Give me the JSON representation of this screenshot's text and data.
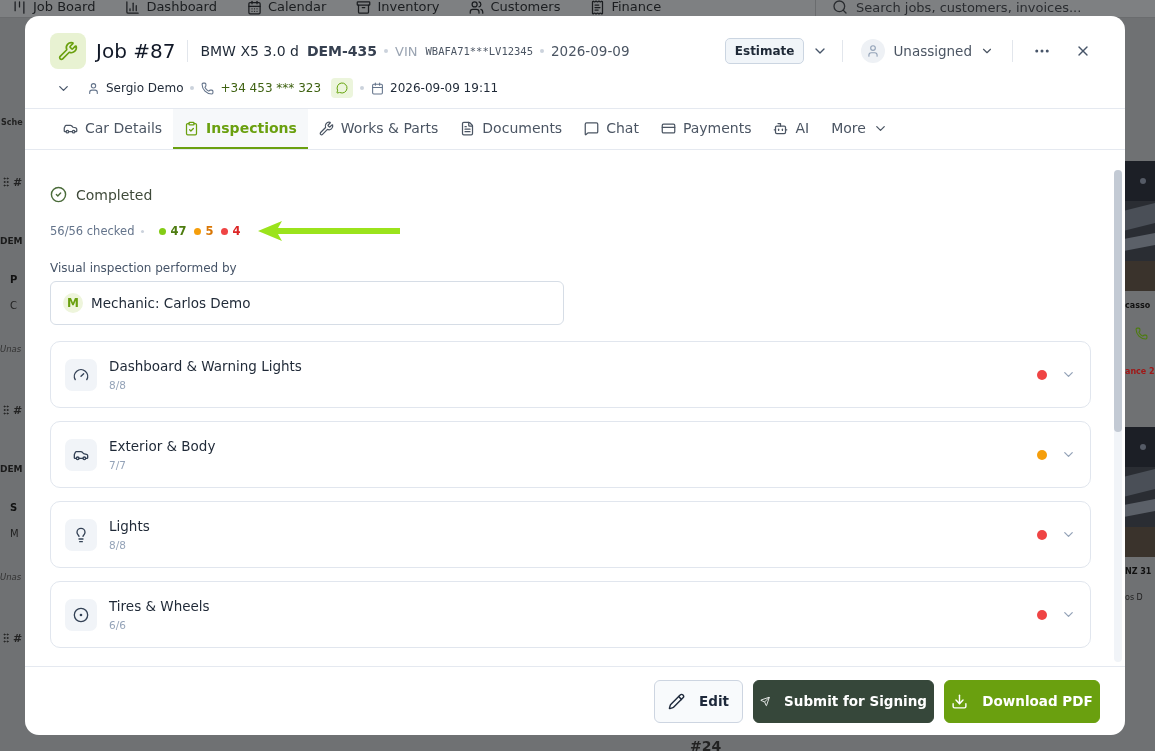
{
  "background": {
    "nav": [
      "Job Board",
      "Dashboard",
      "Calendar",
      "Inventory",
      "Customers",
      "Finance"
    ],
    "search": {
      "placeholder": "Search jobs, customers, invoices..."
    },
    "left_fragments": [
      {
        "kind": "header",
        "text": "Sche"
      },
      {
        "kind": "handle",
        "text": "#"
      },
      {
        "kind": "group",
        "text": "DEM"
      },
      {
        "kind": "title",
        "text": "P"
      },
      {
        "kind": "meta",
        "text": "C"
      },
      {
        "kind": "italic",
        "text": "Unas"
      },
      {
        "kind": "handle",
        "text": "#"
      },
      {
        "kind": "group",
        "text": "DEM"
      },
      {
        "kind": "title",
        "text": "S"
      },
      {
        "kind": "meta",
        "text": "M"
      },
      {
        "kind": "italic",
        "text": "Unas"
      },
      {
        "kind": "handle",
        "text": "#"
      }
    ],
    "right_fragments": [
      {
        "kind": "picture"
      },
      {
        "kind": "title",
        "text": "casso"
      },
      {
        "kind": "phone"
      },
      {
        "kind": "alert",
        "text": "ance 2"
      },
      {
        "kind": "picture"
      },
      {
        "kind": "title",
        "text": "NZ 31"
      },
      {
        "kind": "meta",
        "text": "os D"
      }
    ],
    "bottom_fragment": "#24"
  },
  "job": {
    "title": "Job #87",
    "vehicle": "BMW X5 3.0 d",
    "plate": "DEM-435",
    "vin_label": "VIN",
    "vin": "WBAFA71***LV12345",
    "date": "2026-09-09",
    "status": "Estimate",
    "assignee": "Unassigned",
    "customer": "Sergio Demo",
    "phone": "+34 453 *** 323",
    "appointment": "2026-09-09 19:11"
  },
  "tabs": [
    {
      "label": "Car Details",
      "selected": false
    },
    {
      "label": "Inspections",
      "selected": true
    },
    {
      "label": "Works & Parts",
      "selected": false
    },
    {
      "label": "Documents",
      "selected": false
    },
    {
      "label": "Chat",
      "selected": false
    },
    {
      "label": "Payments",
      "selected": false
    },
    {
      "label": "AI",
      "selected": false
    },
    {
      "label": "More",
      "selected": false
    }
  ],
  "inspection": {
    "status": "Completed",
    "checked": "56/56 checked",
    "counts": [
      {
        "value": "47",
        "color": "#84cc16"
      },
      {
        "value": "5",
        "color": "#f59e0b"
      },
      {
        "value": "4",
        "color": "#ef4444"
      }
    ],
    "performed_by_label": "Visual inspection performed by",
    "performer_initial": "M",
    "performer": "Mechanic: Carlos Demo",
    "sections": [
      {
        "kind": "dashboard",
        "title": "Dashboard & Warning Lights",
        "count": "8/8",
        "color": "#ef4444",
        "expanded": false
      },
      {
        "kind": "exterior",
        "title": "Exterior & Body",
        "count": "7/7",
        "color": "#f59e0b",
        "expanded": false
      },
      {
        "kind": "lights",
        "title": "Lights",
        "count": "8/8",
        "color": "#ef4444",
        "expanded": false
      },
      {
        "kind": "tires",
        "title": "Tires & Wheels",
        "count": "6/6",
        "color": "#ef4444",
        "expanded": false
      }
    ]
  },
  "footer": {
    "buttons": [
      {
        "kind": "edit",
        "label": "Edit"
      },
      {
        "kind": "submit",
        "label": "Submit for Signing"
      },
      {
        "kind": "download",
        "label": "Download PDF"
      }
    ]
  }
}
